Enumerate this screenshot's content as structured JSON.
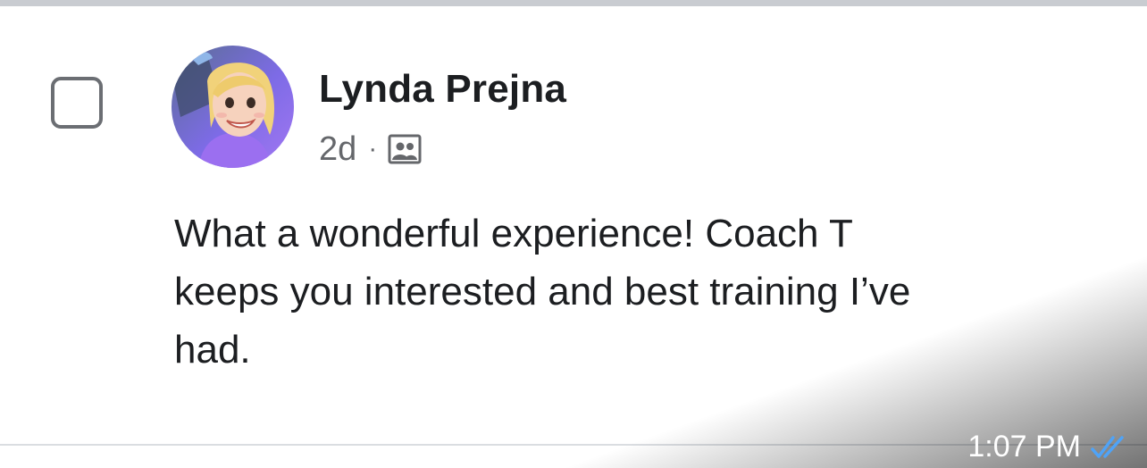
{
  "post": {
    "author_name": "Lynda Prejna",
    "age": "2d",
    "separator": "·",
    "audience_icon": "group-audience-icon",
    "text_lines": [
      "What a wonderful experience! Coach T",
      "keeps you interested and best training I’ve",
      "had."
    ]
  },
  "overlay": {
    "time": "1:07 PM",
    "status_icon": "double-check-read-icon"
  },
  "colors": {
    "text_primary": "#1c1e21",
    "text_secondary": "#65676b",
    "checkbox_border": "#6b6e73",
    "divider": "#c9ccd1",
    "read_tick": "#4fa3f7",
    "avatar_bg": "#8a6cf0"
  }
}
